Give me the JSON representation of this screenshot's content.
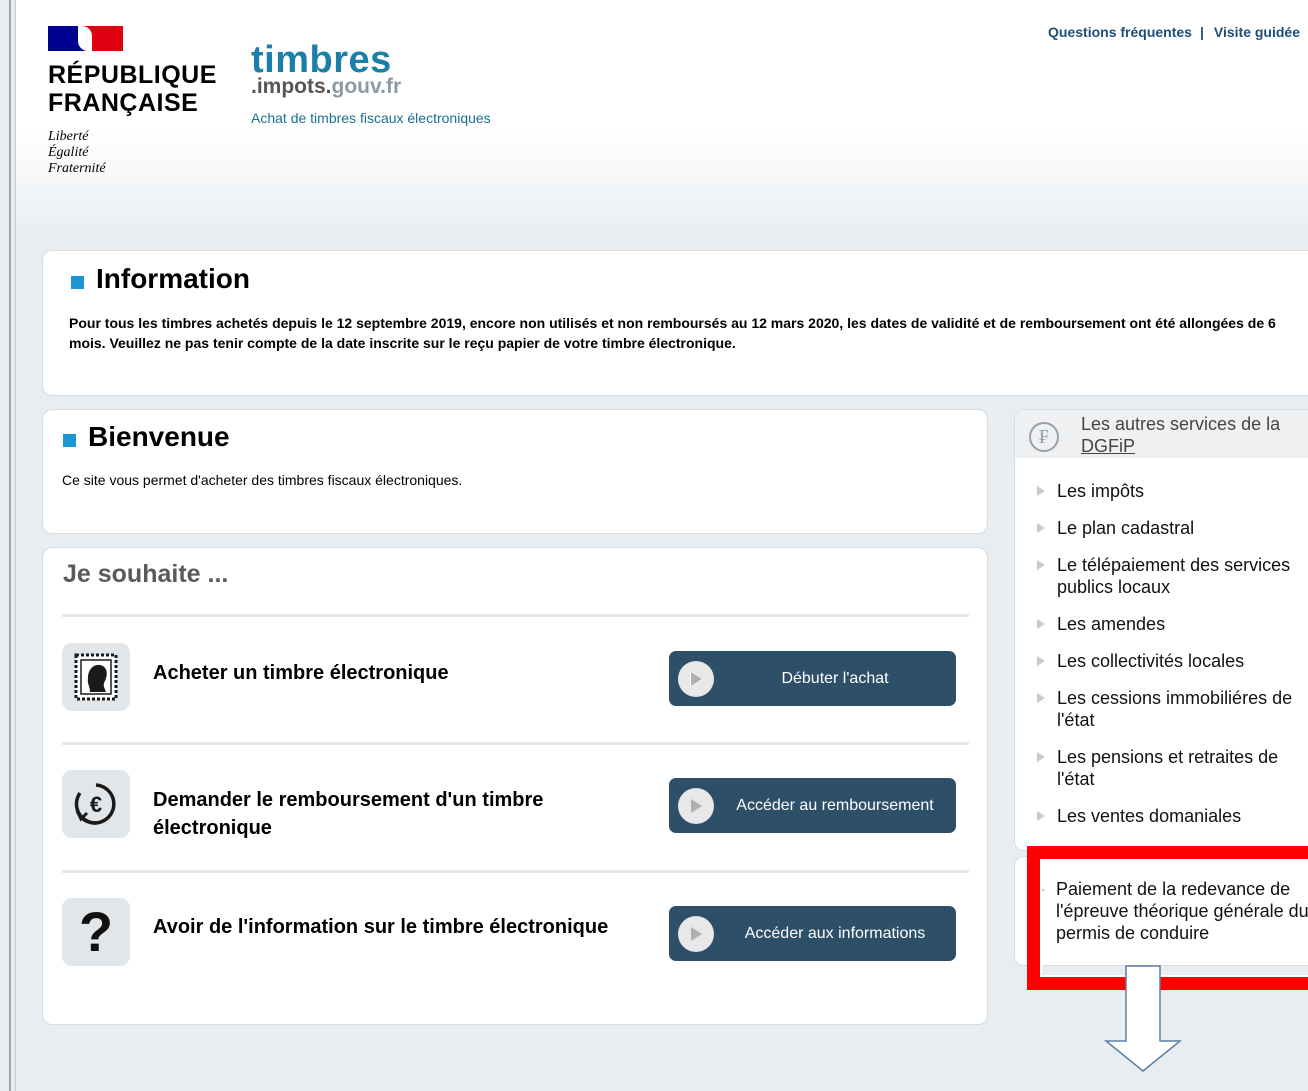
{
  "header": {
    "republique_line1": "RÉPUBLIQUE",
    "republique_line2": "FRANÇAISE",
    "motto": [
      "Liberté",
      "Égalité",
      "Fraternité"
    ],
    "brand_title": "timbres",
    "brand_domain_prefix": ".impots.",
    "brand_domain_suffix": "gouv.fr",
    "brand_subtitle": "Achat de timbres fiscaux électroniques",
    "links": {
      "faq": "Questions fréquentes",
      "separator": "|",
      "tour": "Visite guidée"
    }
  },
  "info": {
    "title": "Information",
    "text": "Pour tous les timbres achetés depuis le 12 septembre 2019, encore non utilisés et non remboursés au 12 mars 2020, les dates de validité et de remboursement ont été allongées de 6 mois. Veuillez ne pas tenir compte de la date inscrite sur le reçu papier de votre timbre électronique."
  },
  "welcome": {
    "title": "Bienvenue",
    "text": "Ce site vous permet d'acheter des timbres fiscaux électroniques."
  },
  "wish": {
    "title": "Je souhaite ...",
    "rows": [
      {
        "label": "Acheter un timbre électronique",
        "button": "Débuter l'achat",
        "icon": "stamp-icon"
      },
      {
        "label": "Demander le remboursement d'un timbre électronique",
        "button": "Accéder au remboursement",
        "icon": "euro-refund-icon"
      },
      {
        "label": "Avoir de l'information sur le timbre électronique",
        "button": "Accéder aux informations",
        "icon": "question-icon"
      }
    ]
  },
  "services": {
    "title_line1": "Les autres services de la",
    "title_line2": "DGFiP",
    "items": [
      "Les impôts",
      "Le plan cadastral",
      "Le télépaiement des services publics locaux",
      "Les amendes",
      "Les collectivités locales",
      "Les cessions immobiliéres de l'état",
      "Les pensions et retraites de l'état",
      "Les ventes domaniales"
    ]
  },
  "extra": {
    "text": "Paiement de la redevance de l'épreuve théorique générale du permis de conduire"
  },
  "colors": {
    "accent": "#1b95d4",
    "button": "#2e4f68",
    "highlight": "#ff0000",
    "brand": "#1b7fa9"
  }
}
